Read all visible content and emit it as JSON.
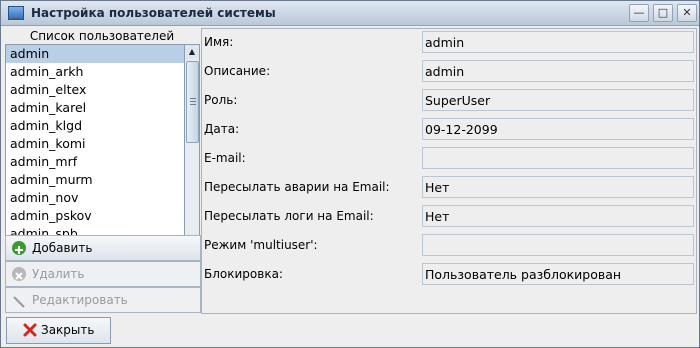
{
  "window": {
    "title": "Настройка пользователей системы"
  },
  "titlebar_buttons": {
    "minimize": "—",
    "maximize": "□",
    "close": "✕"
  },
  "users": {
    "header": "Список пользователей",
    "items": [
      "admin",
      "admin_arkh",
      "admin_eltex",
      "admin_karel",
      "admin_klgd",
      "admin_komi",
      "admin_mrf",
      "admin_murm",
      "admin_nov",
      "admin_pskov",
      "admin_spb"
    ],
    "selected": "admin"
  },
  "actions": {
    "add": "Добавить",
    "delete": "Удалить",
    "edit": "Редактировать"
  },
  "details": {
    "name_label": "Имя:",
    "name_value": "admin",
    "description_label": "Описание:",
    "description_value": "admin",
    "role_label": "Роль:",
    "role_value": "SuperUser",
    "date_label": "Дата:",
    "date_value": "09-12-2099",
    "email_label": "E-mail:",
    "email_value": "",
    "forward_alarms_label": "Пересылать аварии на Email:",
    "forward_alarms_value": "Нет",
    "forward_logs_label": "Пересылать логи на Email:",
    "forward_logs_value": "Нет",
    "multiuser_label": "Режим 'multiuser':",
    "multiuser_value": "",
    "lock_label": "Блокировка:",
    "lock_value": "Пользователь разблокирован"
  },
  "footer": {
    "close": "Закрыть"
  },
  "colors": {
    "selection": "#b8cfe5",
    "add_icon": "#3d9a2c",
    "close_icon": "#d4281e"
  }
}
